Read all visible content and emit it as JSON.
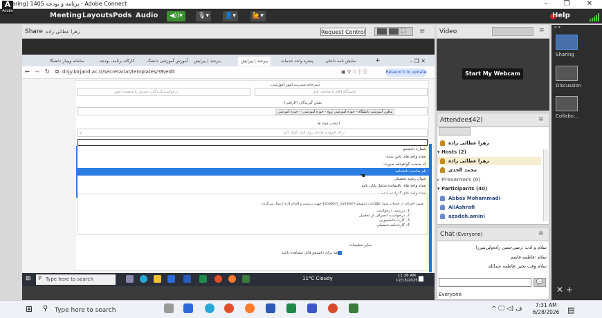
{
  "window": {
    "title": "(Sharing) برنامه و بودجه 1405 - Adobe Connect",
    "min": "–",
    "max": "❐",
    "close": "✕"
  },
  "menubar": {
    "items": [
      "Meeting",
      "Layouts",
      "Pods",
      "Audio"
    ],
    "logo": "A",
    "logo_sub": "Adobe",
    "help": "Help"
  },
  "share": {
    "title": "Share",
    "presenter": "زهرا عطائی زاده",
    "request_control": "Request Control",
    "menu_glyph": "≡"
  },
  "browser": {
    "tabs": [
      "سامانه ویپنار دانشگا",
      "کارگاه برنامه، بودجه",
      "آموزش آموزشی دانشگ",
      "بیرجند | پیرایش",
      "بیرجند | پیرایش",
      "پنجره واحد خدمات",
      "نمایش نامه داخلی"
    ],
    "url": "dnjy.birjand.ac.ir/secretariat/templates/39/edit",
    "relaunch": "Relaunch to update"
  },
  "form": {
    "label_chooser": "دبیرخانه مدیریت امور آموزشی",
    "ph_left": "درخواست‌کنندگان، دستیار یا متصدی امور",
    "ph_right": "دانشگاه ایلام با مباحثی قبل",
    "label_recipients": "نقش گیرندگان (الزامی)",
    "chips": [
      "کارشناس گروه - حوزه آموزشی",
      "کارشناس گروه - حوزه آموزشی",
      "معاون آموزشی دانشگاه - حوزه آموزشی"
    ],
    "label_fields": "انتخاب فیلد ها",
    "fields_ph": "برای افزودن فیلدی روی فیلد کلیک کنید",
    "options": [
      "شماره دانشجو",
      "تعداد واحد های پاس شده",
      "کد ضمنت گواهینامه صورت",
      "نام صاحب دانشنامه",
      "عنوان رشته تحصیلی",
      "تعداد واحد های باقیمانده شامل پایان نامه",
      "تعداد واحد های گذرانده شده",
      "تحصیل"
    ],
    "template_text": "ضمن احترام، از خدمات شما، اطلاعات دانشجو {student_number} جهت بررسی و اقدام لازم ارسال می‌گردد.",
    "list": [
      "1. بررسی درخواست",
      "2. درخواست انصراف از تحصیل",
      "3. کارت دانشجویی",
      "4. کارت‌نامه تحصیلی"
    ],
    "settings_label": "سایر تنظیمات",
    "checkbox_label": "نامه برای دانشجو قابل مشاهده باشد"
  },
  "inner_taskbar": {
    "search": "Type here to search",
    "weather": "11°C  Cloudy",
    "time": "11:36 AM",
    "date": "12/15/2025"
  },
  "video": {
    "title": "Video",
    "webcam_button": "Start My Webcam"
  },
  "attendees": {
    "title": "Attendees",
    "count": "(42)",
    "self": "زهرا عطائی زاده",
    "hosts_label": "Hosts (2)",
    "hosts": [
      "زهرا عطائی زاده",
      "محمد الحدی"
    ],
    "presenters_label": "Presenters (0)",
    "participants_label": "Participants (40)",
    "participants": [
      "Abbas Mohammadi",
      "AliAshrafi",
      "azadeh.amini"
    ]
  },
  "chat": {
    "title": "Chat",
    "scope": "(Everyone)",
    "messages": [
      "سلام و ادب :رضی‌حسن زاده‌ولی‌میرزا",
      "سلام :فاطمه قاسم",
      "سلام وقت بخیر :فاطمه عبدالله"
    ],
    "recipient": "Everyone"
  },
  "layouts": [
    "Sharing",
    "Discussion",
    "Collabo..."
  ],
  "taskbar": {
    "search": "Type here to search",
    "time": "7:31 AM",
    "date": "6/28/2026"
  },
  "colors": {
    "accent": "#2a7de1",
    "menubar": "#2d2d2d",
    "record": "#e02020",
    "speaker_on": "#3a8f2f"
  }
}
